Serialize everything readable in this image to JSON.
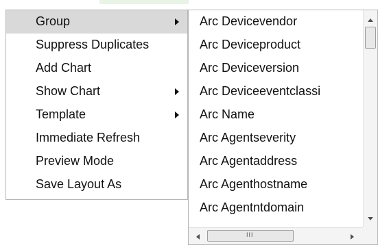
{
  "menu": {
    "items": [
      {
        "label": "Group",
        "has_submenu": true,
        "highlighted": true
      },
      {
        "label": "Suppress Duplicates",
        "has_submenu": false
      },
      {
        "label": "Add Chart",
        "has_submenu": false
      },
      {
        "label": "Show Chart",
        "has_submenu": true
      },
      {
        "label": "Template",
        "has_submenu": true
      },
      {
        "label": "Immediate Refresh",
        "has_submenu": false
      },
      {
        "label": "Preview Mode",
        "has_submenu": false
      },
      {
        "label": "Save Layout As",
        "has_submenu": false
      }
    ]
  },
  "submenu": {
    "items": [
      "Arc Devicevendor",
      "Arc Deviceproduct",
      "Arc Deviceversion",
      "Arc Deviceeventclassi",
      "Arc Name",
      "Arc Agentseverity",
      "Arc Agentaddress",
      "Arc Agenthostname",
      "Arc Agentntdomain"
    ],
    "horizontal_scrollbar_grip": "III"
  },
  "colors": {
    "highlight": "#d9d9d9",
    "border": "#b6b6b6",
    "text": "#111111"
  }
}
